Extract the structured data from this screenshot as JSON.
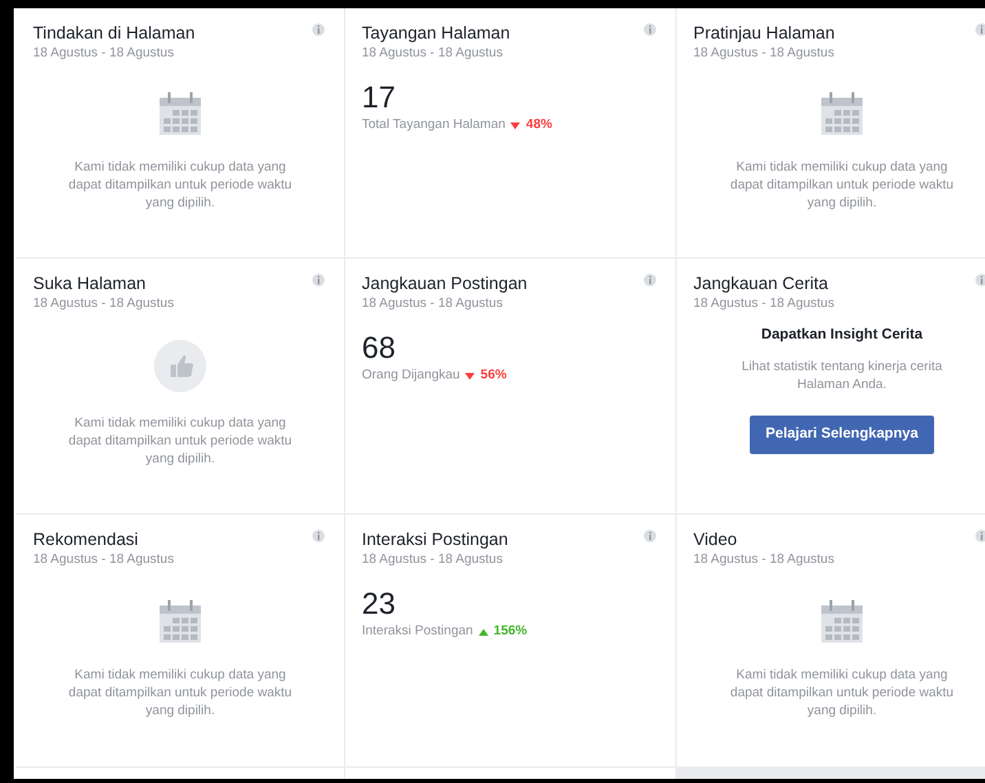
{
  "cards": [
    {
      "kind": "calendar",
      "title": "Tindakan di Halaman",
      "date": "18 Agustus - 18 Agustus",
      "message": "Kami tidak memiliki cukup data yang dapat ditampilkan untuk periode waktu yang dipilih."
    },
    {
      "kind": "metric",
      "title": "Tayangan Halaman",
      "date": "18 Agustus - 18 Agustus",
      "value": "17",
      "label": "Total Tayangan Halaman",
      "change": "48%",
      "rising": false
    },
    {
      "kind": "calendar",
      "title": "Pratinjau Halaman",
      "date": "18 Agustus - 18 Agustus",
      "message": "Kami tidak memiliki cukup data yang dapat ditampilkan untuk periode waktu yang dipilih."
    },
    {
      "kind": "likes",
      "title": "Suka Halaman",
      "date": "18 Agustus - 18 Agustus",
      "message": "Kami tidak memiliki cukup data yang dapat ditampilkan untuk periode waktu yang dipilih."
    },
    {
      "kind": "metric",
      "title": "Jangkauan Postingan",
      "date": "18 Agustus - 18 Agustus",
      "value": "68",
      "label": "Orang Dijangkau",
      "change": "56%",
      "rising": false
    },
    {
      "kind": "promo",
      "title": "Jangkauan Cerita",
      "date": "18 Agustus - 18 Agustus",
      "heading": "Dapatkan Insight Cerita",
      "text": "Lihat statistik tentang kinerja cerita Halaman Anda.",
      "button": "Pelajari Selengkapnya"
    },
    {
      "kind": "calendar",
      "title": "Rekomendasi",
      "date": "18 Agustus - 18 Agustus",
      "message": "Kami tidak memiliki cukup data yang dapat ditampilkan untuk periode waktu yang dipilih."
    },
    {
      "kind": "metric",
      "title": "Interaksi Postingan",
      "date": "18 Agustus - 18 Agustus",
      "value": "23",
      "label": "Interaksi Postingan",
      "change": "156%",
      "rising": true
    },
    {
      "kind": "calendar",
      "title": "Video",
      "date": "18 Agustus - 18 Agustus",
      "message": "Kami tidak memiliki cukup data yang dapat ditampilkan untuk periode waktu yang dipilih."
    }
  ]
}
